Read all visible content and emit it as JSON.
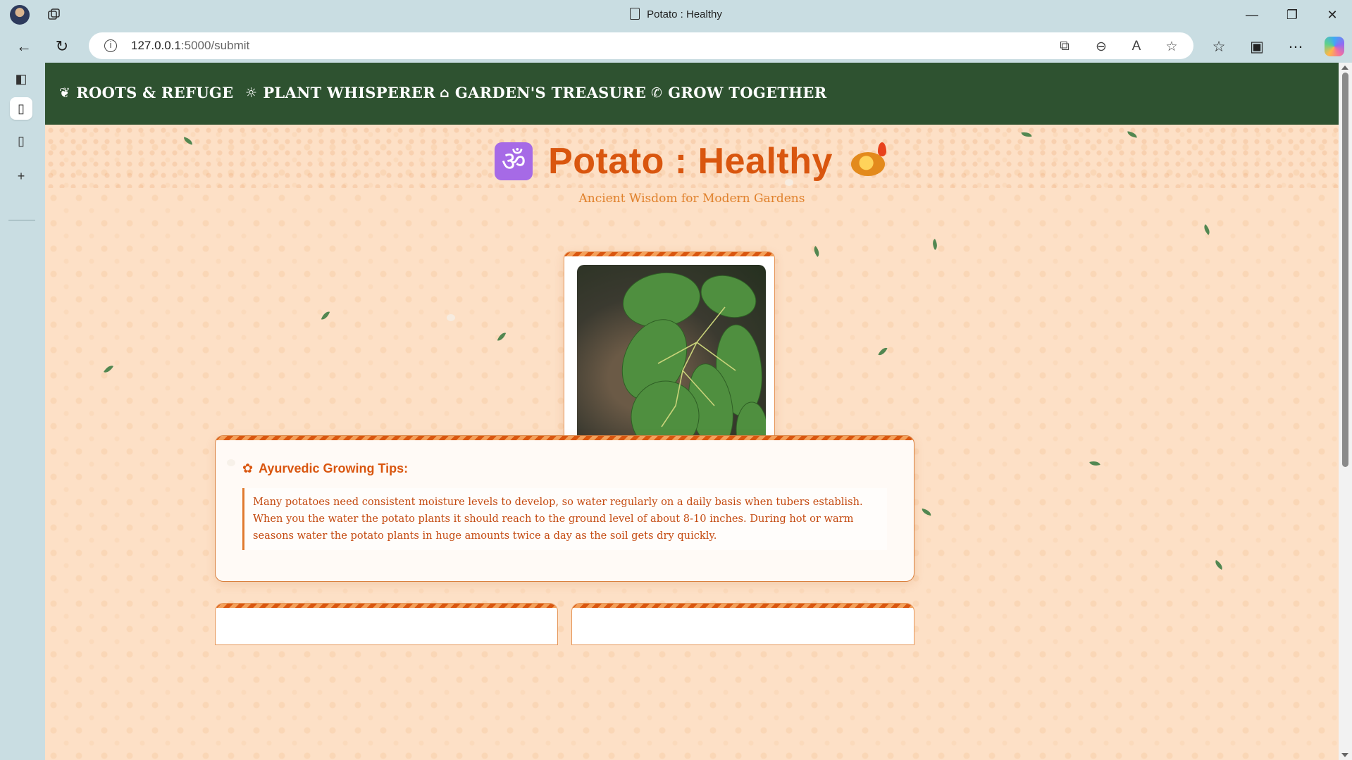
{
  "browser": {
    "window_title": "Potato : Healthy",
    "url_host": "127.0.0.1",
    "url_rest": ":5000/submit"
  },
  "nav": {
    "items": [
      {
        "icon": "leaf-icon",
        "glyph": "❦",
        "label": "ROOTS & REFUGE"
      },
      {
        "icon": "lightbulb-icon",
        "glyph": "☼",
        "label": "PLANT WHISPERER"
      },
      {
        "icon": "shopping-bag-icon",
        "glyph": "⌂",
        "label": "GARDEN'S TREASURE"
      },
      {
        "icon": "phone-icon",
        "glyph": "✆",
        "label": "GROW TOGETHER"
      }
    ]
  },
  "header": {
    "title": "Potato : Healthy",
    "om_glyph": "ॐ",
    "subtitle": "Ancient Wisdom for Modern Gardens"
  },
  "tips": {
    "heading": "Ayurvedic Growing Tips:",
    "icon": "gear-icon",
    "body": "Many potatoes need consistent moisture levels to develop, so water regularly on a daily basis when tubers establish. When you the water the potato plants it should reach to the ground level of about 8-10 inches. During hot or warm seasons water the potato plants in huge amounts twice a day as the soil gets dry quickly."
  },
  "colors": {
    "nav_bg": "#2e5230",
    "accent": "#d9560f",
    "page_bg": "#fde0c6",
    "om_bg": "#a66ae6"
  }
}
